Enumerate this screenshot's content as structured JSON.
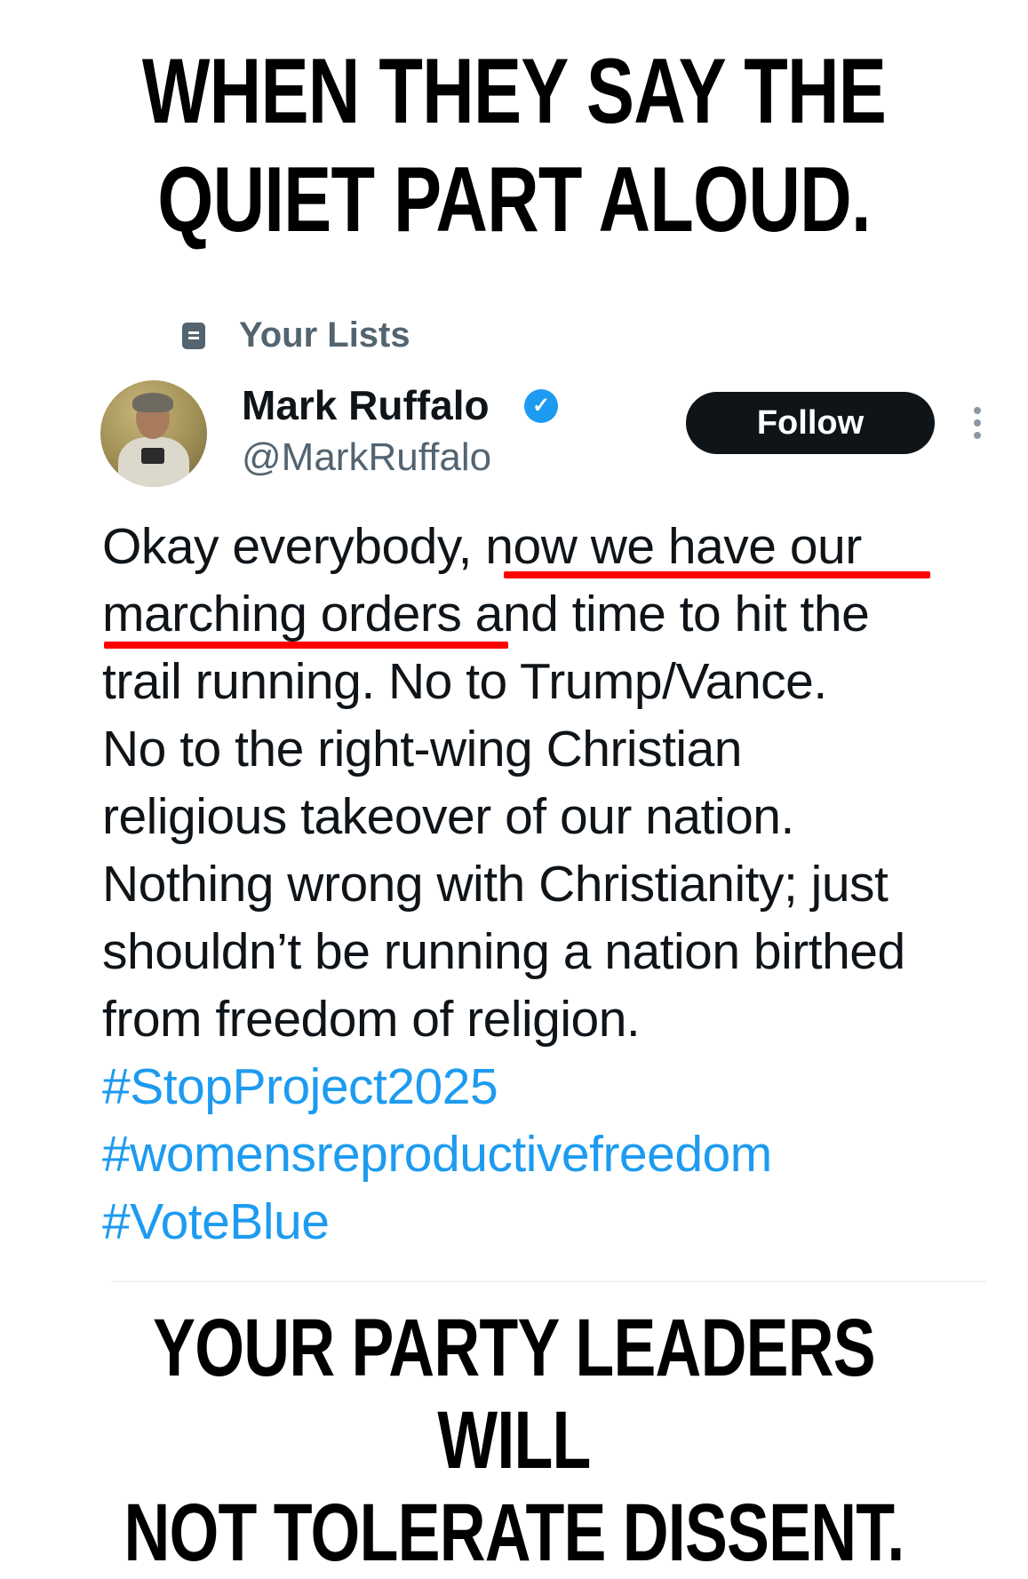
{
  "captions": {
    "top_line1": "WHEN THEY SAY THE",
    "top_line2": "QUIET PART ALOUD.",
    "bottom_line1": "YOUR PARTY LEADERS WILL",
    "bottom_line2": "NOT TOLERATE DISSENT."
  },
  "context": {
    "lists_label": "Your Lists"
  },
  "author": {
    "name": "Mark Ruffalo",
    "handle": "@MarkRuffalo",
    "verified_mark": "✓"
  },
  "actions": {
    "follow_label": "Follow"
  },
  "tweet": {
    "lines": [
      "Okay everybody, now we have our",
      "marching orders and time to hit the",
      "trail running. No to Trump/Vance.",
      "No to the right-wing Christian",
      "religious takeover of our nation.",
      "Nothing wrong with Christianity; just",
      "shouldn’t be running a nation birthed",
      "from freedom of religion."
    ],
    "hashtags": [
      "#StopProject2025",
      "#womensreproductivefreedom",
      "#VoteBlue"
    ]
  },
  "colors": {
    "text": "#0f1419",
    "secondary": "#536471",
    "link": "#1d9bf0",
    "annotation_underline": "#ff0000",
    "follow_button_bg": "#0f1419"
  },
  "icons": [
    "list-icon",
    "verified-badge-icon",
    "more-options-icon"
  ]
}
